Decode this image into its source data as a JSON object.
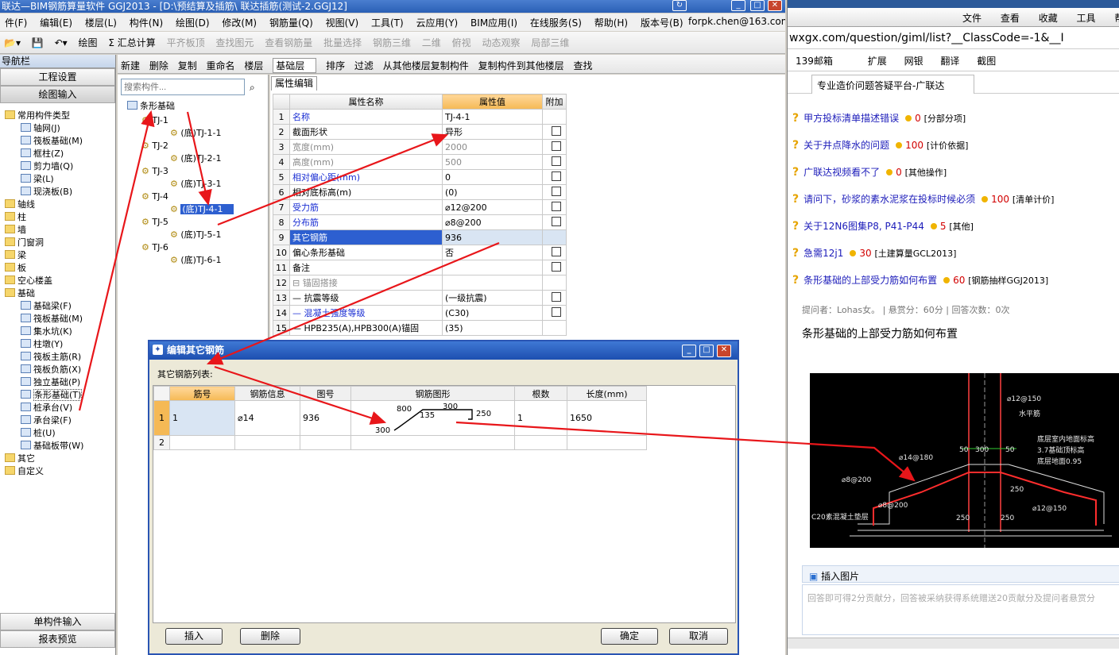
{
  "window": {
    "title": "联达—BIM钢筋算量软件 GGJ2013 - [D:\\预结算及插筋\\ 联达插筋(测试-2.GGJ12]"
  },
  "menu": [
    "件(F)",
    "编辑(E)",
    "楼层(L)",
    "构件(N)",
    "绘图(D)",
    "修改(M)",
    "钢筋量(Q)",
    "视图(V)",
    "工具(T)",
    "云应用(Y)",
    "BIM应用(I)",
    "在线服务(S)",
    "帮助(H)",
    "版本号(B)"
  ],
  "account": "forpk.chen@163.com",
  "toolbar1": {
    "draw": "绘图",
    "sum": "Σ 汇总计算",
    "align_top": "平齐板顶",
    "find_elem": "查找图元",
    "view_rebar": "查看钢筋量",
    "batch_select": "批量选择",
    "rebar_3d": "钢筋三维",
    "view_mode": "二维",
    "top_view": "俯视",
    "dynamic": "动态观察",
    "local_3d": "局部三维"
  },
  "toolbar2": {
    "new": "新建",
    "delete": "删除",
    "copy": "复制",
    "rename": "重命名",
    "floor_label": "楼层",
    "floor_value": "基础层",
    "sort": "排序",
    "filter": "过滤",
    "copy_from": "从其他楼层复制构件",
    "copy_to": "复制构件到其他楼层",
    "find": "查找"
  },
  "nav": {
    "title": "导航栏",
    "project_settings": "工程设置",
    "draw_input": "绘图输入",
    "single_input": "单构件输入",
    "report_preview": "报表预览",
    "items": [
      {
        "label": "常用构件类型",
        "type": "folder"
      },
      {
        "label": "轴网(J)",
        "type": "child"
      },
      {
        "label": "筏板基础(M)",
        "type": "child"
      },
      {
        "label": "框柱(Z)",
        "type": "child"
      },
      {
        "label": "剪力墙(Q)",
        "type": "child"
      },
      {
        "label": "梁(L)",
        "type": "child"
      },
      {
        "label": "现浇板(B)",
        "type": "child"
      },
      {
        "label": "轴线",
        "type": "folder"
      },
      {
        "label": "柱",
        "type": "folder"
      },
      {
        "label": "墙",
        "type": "folder"
      },
      {
        "label": "门窗洞",
        "type": "folder"
      },
      {
        "label": "梁",
        "type": "folder"
      },
      {
        "label": "板",
        "type": "folder"
      },
      {
        "label": "空心楼盖",
        "type": "folder"
      },
      {
        "label": "基础",
        "type": "folder"
      },
      {
        "label": "基础梁(F)",
        "type": "child"
      },
      {
        "label": "筏板基础(M)",
        "type": "child"
      },
      {
        "label": "集水坑(K)",
        "type": "child"
      },
      {
        "label": "柱墩(Y)",
        "type": "child"
      },
      {
        "label": "筏板主筋(R)",
        "type": "child"
      },
      {
        "label": "筏板负筋(X)",
        "type": "child"
      },
      {
        "label": "独立基础(P)",
        "type": "child"
      },
      {
        "label": "条形基础(T)",
        "type": "child"
      },
      {
        "label": "桩承台(V)",
        "type": "child"
      },
      {
        "label": "承台梁(F)",
        "type": "child"
      },
      {
        "label": "桩(U)",
        "type": "child"
      },
      {
        "label": "基础板带(W)",
        "type": "child"
      },
      {
        "label": "其它",
        "type": "folder"
      },
      {
        "label": "自定义",
        "type": "folder"
      }
    ]
  },
  "component_tree": {
    "search_placeholder": "搜索构件...",
    "root": "条形基础",
    "items": [
      {
        "label": "TJ-1",
        "child": "(底)TJ-1-1"
      },
      {
        "label": "TJ-2",
        "child": "(底)TJ-2-1"
      },
      {
        "label": "TJ-3",
        "child": "(底)TJ-3-1"
      },
      {
        "label": "TJ-4",
        "child": "(底)TJ-4-1"
      },
      {
        "label": "TJ-5",
        "child": "(底)TJ-5-1"
      },
      {
        "label": "TJ-6",
        "child": "(底)TJ-6-1"
      }
    ]
  },
  "properties": {
    "tab": "属性编辑",
    "col_name": "属性名称",
    "col_value": "属性值",
    "col_extra": "附加",
    "rows": [
      {
        "n": "1",
        "name": "名称",
        "value": "TJ-4-1",
        "style": "blue",
        "chk": false
      },
      {
        "n": "2",
        "name": "截面形状",
        "value": "异形",
        "style": "",
        "chk": true
      },
      {
        "n": "3",
        "name": "宽度(mm)",
        "value": "2000",
        "style": "grey",
        "chk": true
      },
      {
        "n": "4",
        "name": "高度(mm)",
        "value": "500",
        "style": "grey",
        "chk": true
      },
      {
        "n": "5",
        "name": "相对偏心距(mm)",
        "value": "0",
        "style": "blue",
        "chk": true
      },
      {
        "n": "6",
        "name": "相对底标高(m)",
        "value": "(0)",
        "style": "",
        "chk": true
      },
      {
        "n": "7",
        "name": "受力筋",
        "value": "⌀12@200",
        "style": "blue",
        "chk": true
      },
      {
        "n": "8",
        "name": "分布筋",
        "value": "⌀8@200",
        "style": "blue",
        "chk": true
      },
      {
        "n": "9",
        "name": "其它钢筋",
        "value": "936",
        "style": "sel",
        "chk": false
      },
      {
        "n": "10",
        "name": "偏心条形基础",
        "value": "否",
        "style": "",
        "chk": true
      },
      {
        "n": "11",
        "name": "备注",
        "value": "",
        "style": "",
        "chk": true
      },
      {
        "n": "12",
        "name": "⊟ 锚固搭接",
        "value": "",
        "style": "grey",
        "chk": false
      },
      {
        "n": "13",
        "name": "— 抗震等级",
        "value": "(一级抗震)",
        "style": "",
        "chk": true
      },
      {
        "n": "14",
        "name": "— 混凝土强度等级",
        "value": "(C30)",
        "style": "blue",
        "chk": true
      },
      {
        "n": "15",
        "name": "— HPB235(A),HPB300(A)锚固",
        "value": "(35)",
        "style": "",
        "chk": false
      }
    ]
  },
  "dialog": {
    "title": "编辑其它钢筋",
    "list_label": "其它钢筋列表:",
    "headers": [
      "筋号",
      "钢筋信息",
      "图号",
      "钢筋图形",
      "根数",
      "长度(mm)"
    ],
    "rows": [
      {
        "n": "1",
        "bar_no": "1",
        "info": "⌀14",
        "fig": "936",
        "count": "1",
        "length": "1650"
      },
      {
        "n": "2",
        "bar_no": "",
        "info": "",
        "fig": "",
        "count": "",
        "length": ""
      }
    ],
    "shape_dims": {
      "a": "800",
      "b": "135",
      "c": "300",
      "d": "250",
      "e": "300"
    },
    "insert": "插入",
    "delete": "删除",
    "ok": "确定",
    "cancel": "取消"
  },
  "browser": {
    "menu": [
      "文件",
      "查看",
      "收藏",
      "工具",
      "帮"
    ],
    "url": "wxgx.com/question/giml/list?__ClassCode=-1&__I",
    "bookmarks": [
      "139邮箱",
      "扩展",
      "网银",
      "翻译",
      "截图"
    ],
    "tab_title": "专业造价问题答疑平台-广联达",
    "questions": [
      {
        "title": "甲方投标清单描述错误",
        "points": "0",
        "cat": "[分部分项]"
      },
      {
        "title": "关于井点降水的问题",
        "points": "100",
        "cat": "[计价依据]"
      },
      {
        "title": "广联达视频看不了",
        "points": "0",
        "cat": "[其他操作]"
      },
      {
        "title": "请问下，砂浆的素水泥浆在投标时候必须",
        "points": "100",
        "cat": "[清单计价]"
      },
      {
        "title": "关于12N6图集P8, P41-P44",
        "points": "5",
        "cat": "[其他]"
      },
      {
        "title": "急需12j1",
        "points": "30",
        "cat": "[土建算量GCL2013]"
      },
      {
        "title": "条形基础的上部受力筋如何布置",
        "points": "60",
        "cat": "[钢筋抽样GGJ2013]"
      }
    ],
    "asker": "提问者：Lohas女。 | 悬赏分：60分 | 回答次数：0次",
    "question_text": "条形基础的上部受力筋如何布置",
    "cad_labels": [
      "⌀12@150",
      "水平筋",
      "⌀14@180",
      "⌀8@200",
      "⌀8@200",
      "⌀12@150",
      "50",
      "300",
      "50",
      "250",
      "250",
      "250",
      "C20素混凝土垫层",
      "底层室内地面标高",
      "3.7基础顶标高",
      "底层地面0.95"
    ],
    "insert_image": "插入图片",
    "answer_placeholder": "回答即可得2分贡献分，回答被采纳获得系统赠送20贡献分及提问者悬赏分"
  },
  "colors": {
    "arrow": "#e8161a",
    "title_blue": "#2a5fb5",
    "header_orange": "#f5b955",
    "selection": "#2d5fd0"
  }
}
